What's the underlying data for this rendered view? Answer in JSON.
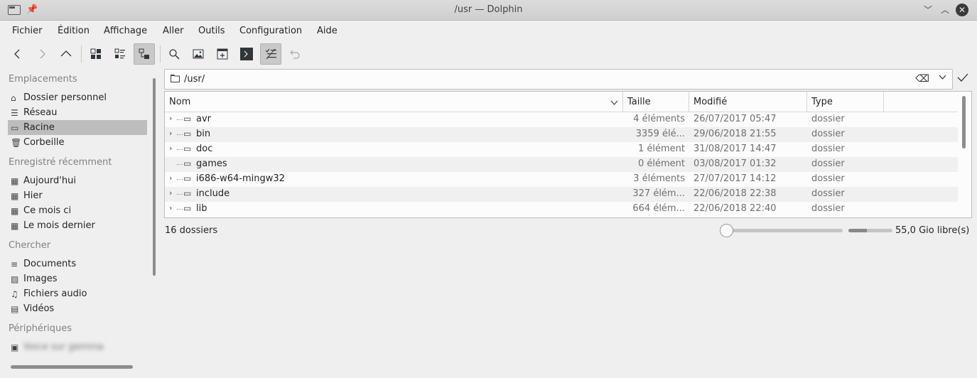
{
  "window": {
    "title": "/usr — Dolphin",
    "buttons": {
      "minimize": "﹀",
      "maximize": "︿",
      "close": "✕"
    }
  },
  "menu": [
    "Fichier",
    "Édition",
    "Affichage",
    "Aller",
    "Outils",
    "Configuration",
    "Aide"
  ],
  "toolbar": {
    "icons": [
      "back-icon",
      "forward-icon",
      "up-icon",
      "icons-view-icon",
      "compact-view-icon",
      "details-view-icon",
      "search-icon",
      "preview-icon",
      "split-icon",
      "terminal-icon",
      "select-mode-icon",
      "undo-icon"
    ]
  },
  "sidebar": {
    "sections": [
      {
        "title": "Emplacements",
        "items": [
          {
            "label": "Dossier personnel",
            "icon": "home-icon"
          },
          {
            "label": "Réseau",
            "icon": "network-icon"
          },
          {
            "label": "Racine",
            "icon": "folder-icon",
            "selected": true
          },
          {
            "label": "Corbeille",
            "icon": "trash-icon"
          }
        ]
      },
      {
        "title": "Enregistré récemment",
        "items": [
          {
            "label": "Aujourd'hui",
            "icon": "calendar-icon"
          },
          {
            "label": "Hier",
            "icon": "calendar-icon"
          },
          {
            "label": "Ce mois ci",
            "icon": "calendar-icon"
          },
          {
            "label": "Le mois dernier",
            "icon": "calendar-icon"
          }
        ]
      },
      {
        "title": "Chercher",
        "items": [
          {
            "label": "Documents",
            "icon": "document-icon"
          },
          {
            "label": "Images",
            "icon": "image-icon"
          },
          {
            "label": "Fichiers audio",
            "icon": "music-icon"
          },
          {
            "label": "Vidéos",
            "icon": "video-icon"
          }
        ]
      },
      {
        "title": "Périphériques",
        "items": [
          {
            "label": "Voice sur gemma",
            "icon": "drive-icon",
            "blurred": true
          }
        ]
      }
    ]
  },
  "location": {
    "path": "/usr/"
  },
  "columns": {
    "name": "Nom",
    "size": "Taille",
    "modified": "Modifié",
    "type": "Type"
  },
  "files": [
    {
      "name": "avr",
      "size": "4 éléments",
      "modified": "26/07/2017 05:47",
      "type": "dossier",
      "expandable": true
    },
    {
      "name": "bin",
      "size": "3359 élé...",
      "modified": "29/06/2018 21:55",
      "type": "dossier",
      "expandable": true
    },
    {
      "name": "doc",
      "size": "1 élément",
      "modified": "31/08/2017 14:47",
      "type": "dossier",
      "expandable": true
    },
    {
      "name": "games",
      "size": "0 élément",
      "modified": "03/08/2017 01:32",
      "type": "dossier",
      "expandable": false
    },
    {
      "name": "i686-w64-mingw32",
      "size": "3 éléments",
      "modified": "27/07/2017 14:12",
      "type": "dossier",
      "expandable": true
    },
    {
      "name": "include",
      "size": "327 élém...",
      "modified": "22/06/2018 22:38",
      "type": "dossier",
      "expandable": true
    },
    {
      "name": "lib",
      "size": "664 élém...",
      "modified": "22/06/2018 22:40",
      "type": "dossier",
      "expandable": true
    }
  ],
  "status": {
    "summary": "16 dossiers",
    "free_space": "55,0 Gio libre(s)",
    "zoom_level_fraction": 0.0,
    "disk_used_fraction": 0.42
  }
}
